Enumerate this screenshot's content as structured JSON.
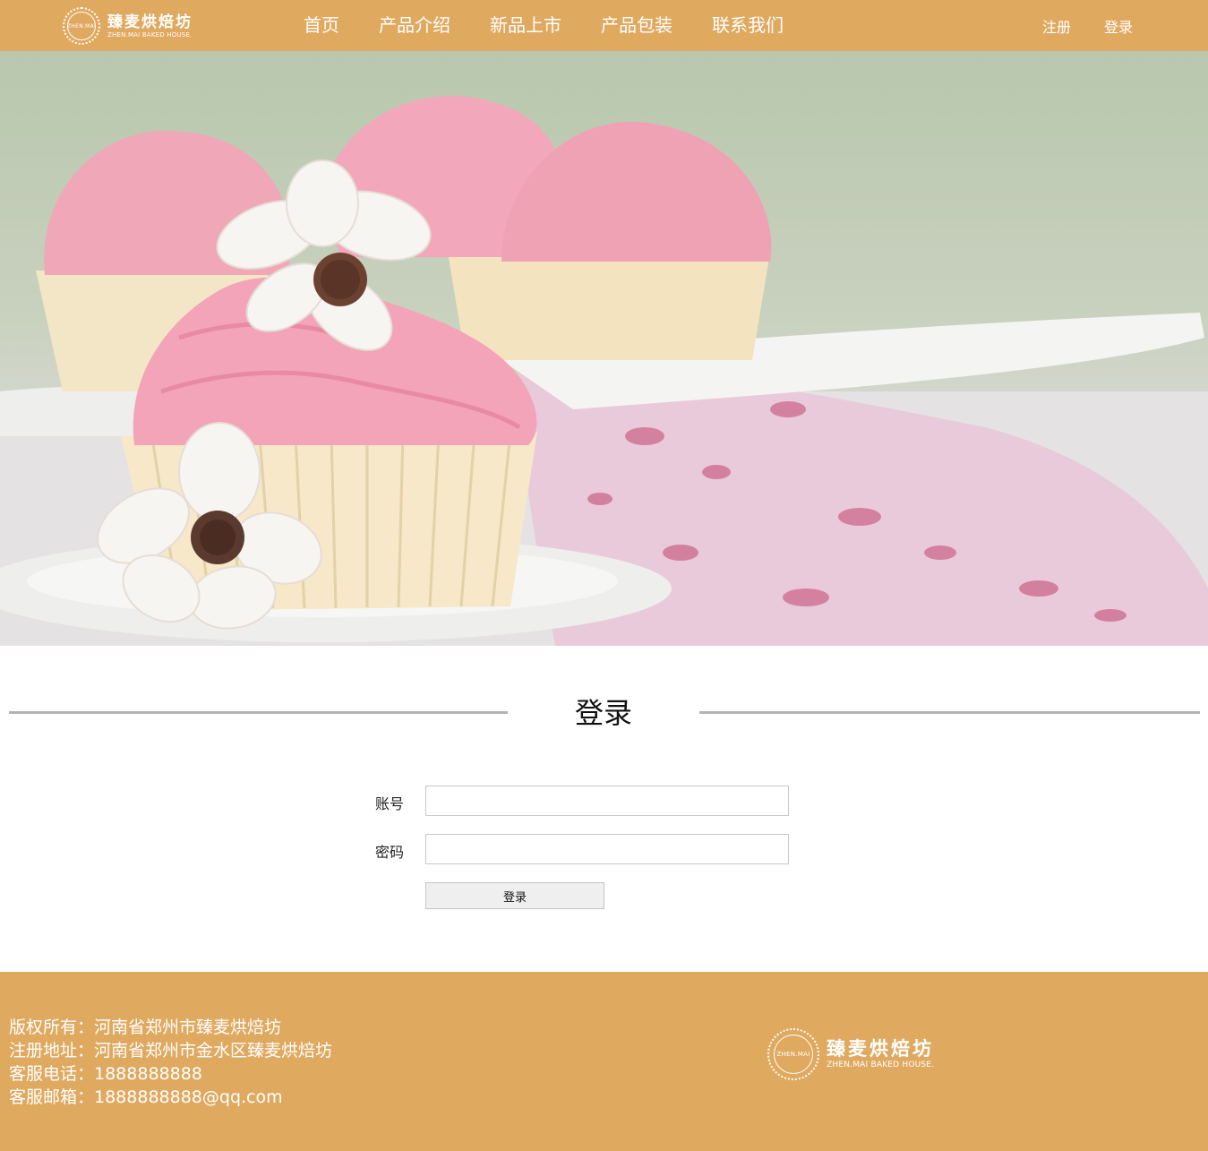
{
  "header": {
    "logo": {
      "badge_text": "ZHEN.MAI",
      "name_cn": "臻麦烘焙坊",
      "name_en": "ZHEN.MAI BAKED HOUSE."
    },
    "nav": [
      "首页",
      "产品介绍",
      "新品上市",
      "产品包装",
      "联系我们"
    ],
    "register": "注册",
    "login": "登录"
  },
  "hero": {
    "image": "pink-frosted-cupcakes-with-white-flowers"
  },
  "login_section": {
    "title": "登录",
    "account_label": "账号",
    "account_value": "",
    "password_label": "密码",
    "password_value": "",
    "submit_label": "登录"
  },
  "footer": {
    "lines": [
      "版权所有：河南省郑州市臻麦烘焙坊",
      "注册地址：河南省郑州市金水区臻麦烘焙坊",
      "客服电话：1888888888",
      "客服邮箱：1888888888@qq.com"
    ],
    "logo": {
      "badge_text": "ZHEN.MAI",
      "name_cn": "臻麦烘焙坊",
      "name_en": "ZHEN.MAI BAKED HOUSE."
    }
  },
  "colors": {
    "brand": "#e0a960",
    "frosting": "#f0a7b8",
    "divider": "#b3b3b3"
  }
}
